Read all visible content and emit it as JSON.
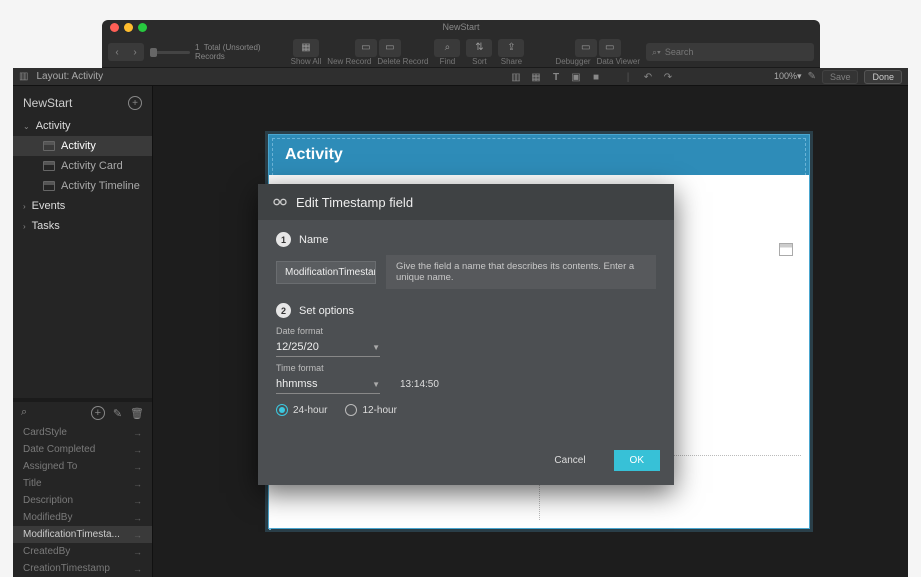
{
  "window": {
    "title": "NewStart"
  },
  "toolbar": {
    "records_total": "1",
    "records_label": "Total (Unsorted)",
    "records_caption": "Records",
    "showall": "Show All",
    "newrecord": "New Record",
    "deleterecord": "Delete Record",
    "find": "Find",
    "sort": "Sort",
    "share": "Share",
    "debugger": "Debugger",
    "dataviewer": "Data Viewer",
    "search_placeholder": "Search"
  },
  "editorTop": {
    "layout_label": "Layout: Activity",
    "zoom": "100%",
    "save": "Save",
    "done": "Done"
  },
  "sidebar": {
    "db_name": "NewStart",
    "groups": [
      {
        "label": "Activity",
        "expanded": true,
        "children": [
          {
            "label": "Activity",
            "selected": true
          },
          {
            "label": "Activity Card",
            "selected": false
          },
          {
            "label": "Activity Timeline",
            "selected": false
          }
        ]
      },
      {
        "label": "Events",
        "expanded": false,
        "children": []
      },
      {
        "label": "Tasks",
        "expanded": false,
        "children": []
      }
    ],
    "fields": [
      "CardStyle",
      "Date Completed",
      "Assigned To",
      "Title",
      "Description",
      "ModifiedBy",
      "ModificationTimesta...",
      "CreatedBy",
      "CreationTimestamp"
    ],
    "selected_field_index": 6
  },
  "layout": {
    "header_title": "Activity"
  },
  "modal": {
    "title": "Edit Timestamp field",
    "step1_label": "Name",
    "name_value": "ModificationTimestamp",
    "name_hint": "Give the field a name that describes its contents. Enter a unique name.",
    "step2_label": "Set options",
    "date_format_label": "Date format",
    "date_format_value": "12/25/20",
    "time_format_label": "Time format",
    "time_format_value": "hhmmss",
    "time_preview": "13:14:50",
    "radio_24": "24-hour",
    "radio_12": "12-hour",
    "cancel": "Cancel",
    "ok": "OK"
  }
}
